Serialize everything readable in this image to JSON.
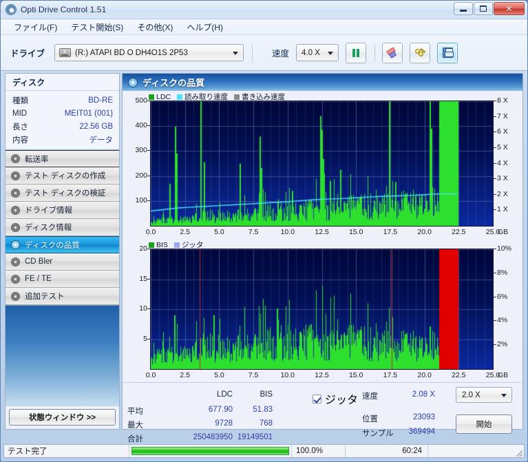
{
  "window": {
    "title": "Opti Drive Control 1.51",
    "icon": "disc-icon",
    "minimize": "–",
    "maximize": "▫",
    "close": "✕"
  },
  "menubar": {
    "items": [
      {
        "label": "ファイル(F)",
        "name": "menu-file"
      },
      {
        "label": "テスト開始(S)",
        "name": "menu-test-start"
      },
      {
        "label": "その他(X)",
        "name": "menu-other"
      },
      {
        "label": "ヘルプ(H)",
        "name": "menu-help"
      }
    ]
  },
  "toolbar": {
    "drive_label": "ドライブ",
    "drive_value": "(R:)   ATAPI BD  O  DH4O1S 2P53",
    "speed_label": "速度",
    "speed_value": "4.0 X",
    "refresh_icon": "refresh-icon",
    "erase_icon": "eraser-icon",
    "keys_icon": "keys-icon",
    "save_icon": "floppy-save-icon"
  },
  "sidebar": {
    "disk_header": "ディスク",
    "disk_info": [
      {
        "key": "種類",
        "value": "BD-RE"
      },
      {
        "key": "MID",
        "value": "MEIT01 (001)"
      },
      {
        "key": "長さ",
        "value": "22.56 GB"
      },
      {
        "key": "内容",
        "value": "データ"
      }
    ],
    "nav": [
      {
        "label": "転送率",
        "selected": false
      },
      {
        "label": "テスト ディスクの作成",
        "selected": false
      },
      {
        "label": "テスト ディスクの検証",
        "selected": false
      },
      {
        "label": "ドライブ情報",
        "selected": false
      },
      {
        "label": "ディスク情報",
        "selected": false
      },
      {
        "label": "ディスクの品質",
        "selected": true
      },
      {
        "label": "CD Bler",
        "selected": false
      },
      {
        "label": "FE / TE",
        "selected": false
      },
      {
        "label": "追加テスト",
        "selected": false
      }
    ],
    "status_window_button": "状態ウィンドウ >>"
  },
  "main": {
    "header_title": "ディスクの品質",
    "header_icon": "disc-quality-icon"
  },
  "stats": {
    "col_headers": [
      "LDC",
      "BIS"
    ],
    "rows": [
      {
        "key": "平均",
        "ldc": "677.90",
        "bis": "51.83"
      },
      {
        "key": "最大",
        "ldc": "9728",
        "bis": "768"
      },
      {
        "key": "合計",
        "ldc": "250483950",
        "bis": "19149501"
      }
    ],
    "jitter_checkbox_label": "ジッタ",
    "jitter_checked": true,
    "speed_label": "速度",
    "speed_value": "2.08 X",
    "speed_select": "2.0 X",
    "position_label": "位置",
    "position_value": "23093",
    "samples_label": "サンプル",
    "samples_value": "369494",
    "start_button": "開始"
  },
  "statusbar": {
    "text": "テスト完了",
    "percent": "100.0%",
    "time": "60:24",
    "progress": 100
  },
  "colors": {
    "ldc_green": "#1aa01a",
    "read_speed_cyan": "#4de3f7",
    "write_speed_gray": "#8a8a8a",
    "bis_green": "#1aa01a",
    "jitter_lilac": "#9aa6ef",
    "plot_bg_top": "#000c44",
    "plot_bg_bottom": "#0a2390",
    "bar_green": "#2ee02e",
    "bar_red": "#e00000",
    "accent_blue": "#2b3ea8"
  },
  "chart_data": [
    {
      "type": "bar",
      "name": "ldc-chart",
      "title": "",
      "legend": [
        {
          "label": "LDC",
          "color": "#1aa01a"
        },
        {
          "label": "読み取り速度",
          "color": "#4de3f7"
        },
        {
          "label": "書き込み速度",
          "color": "#8a8a8a"
        }
      ],
      "legend_position": "top-left",
      "xlabel": "GB",
      "ylabel": "",
      "xlim": [
        0.0,
        25.0
      ],
      "xticks": [
        "0.0",
        "2.5",
        "5.0",
        "7.5",
        "10.0",
        "12.5",
        "15.0",
        "17.5",
        "20.0",
        "22.5",
        "25.0"
      ],
      "xtick_values": [
        0.0,
        2.5,
        5.0,
        7.5,
        10.0,
        12.5,
        15.0,
        17.5,
        20.0,
        22.5,
        25.0
      ],
      "ylim": [
        0,
        500
      ],
      "yticks": [
        "100",
        "200",
        "300",
        "400",
        "500"
      ],
      "ytick_values": [
        100,
        200,
        300,
        400,
        500
      ],
      "y2label": "X",
      "y2lim": [
        0,
        8
      ],
      "y2ticks": [
        "1 X",
        "2 X",
        "3 X",
        "4 X",
        "5 X",
        "6 X",
        "7 X",
        "8 X"
      ],
      "y2tick_values": [
        1,
        2,
        3,
        4,
        5,
        6,
        7,
        8
      ],
      "grid": true,
      "data_end_gb": 22.5,
      "solid_block": {
        "start": 21.1,
        "end": 22.5,
        "color": "#2ee02e"
      },
      "series": [
        {
          "name": "LDC",
          "color": "#1aa01a",
          "kind": "bars",
          "baseline_profile": [
            18,
            22,
            26,
            28,
            30,
            34,
            38,
            40,
            42,
            45,
            48,
            50,
            52,
            55,
            58,
            60,
            62,
            64,
            66,
            68,
            70,
            72,
            74,
            76,
            78,
            80,
            82,
            84,
            86,
            88,
            90,
            92,
            94,
            96,
            98,
            100,
            102,
            104,
            106,
            108
          ],
          "spikes": [
            {
              "x": 1.35,
              "y": 168
            },
            {
              "x": 1.75,
              "y": 398
            },
            {
              "x": 1.85,
              "y": 290
            },
            {
              "x": 3.6,
              "y": 500
            },
            {
              "x": 3.85,
              "y": 255
            },
            {
              "x": 6.5,
              "y": 250
            },
            {
              "x": 7.95,
              "y": 358
            },
            {
              "x": 8.05,
              "y": 232
            },
            {
              "x": 10.3,
              "y": 140
            },
            {
              "x": 12.35,
              "y": 440
            },
            {
              "x": 12.45,
              "y": 385
            },
            {
              "x": 12.6,
              "y": 268
            },
            {
              "x": 12.65,
              "y": 210
            },
            {
              "x": 13.1,
              "y": 180
            },
            {
              "x": 13.85,
              "y": 225
            },
            {
              "x": 17.4,
              "y": 500
            },
            {
              "x": 17.85,
              "y": 175
            },
            {
              "x": 20.35,
              "y": 500
            },
            {
              "x": 20.45,
              "y": 390
            }
          ]
        },
        {
          "name": "読み取り速度",
          "color": "#4de3f7",
          "kind": "line",
          "axis": "right",
          "points": [
            [
              0.0,
              0.95
            ],
            [
              1.0,
              1.05
            ],
            [
              2.0,
              1.15
            ],
            [
              3.0,
              1.2
            ],
            [
              4.0,
              1.25
            ],
            [
              5.0,
              1.3
            ],
            [
              6.0,
              1.35
            ],
            [
              7.0,
              1.4
            ],
            [
              8.0,
              1.45
            ],
            [
              9.0,
              1.5
            ],
            [
              10.0,
              1.55
            ],
            [
              11.0,
              1.62
            ],
            [
              12.0,
              1.68
            ],
            [
              13.0,
              1.72
            ],
            [
              14.0,
              1.75
            ],
            [
              15.0,
              1.8
            ],
            [
              16.0,
              1.85
            ],
            [
              17.0,
              1.9
            ],
            [
              18.0,
              1.92
            ],
            [
              19.0,
              1.95
            ],
            [
              20.0,
              2.0
            ],
            [
              21.0,
              2.05
            ],
            [
              22.4,
              2.05
            ]
          ]
        }
      ]
    },
    {
      "type": "bar",
      "name": "bis-chart",
      "title": "",
      "legend": [
        {
          "label": "BIS",
          "color": "#1aa01a"
        },
        {
          "label": "ジッタ",
          "color": "#9aa6ef"
        }
      ],
      "legend_position": "top-left",
      "xlabel": "GB",
      "ylabel": "",
      "xlim": [
        0.0,
        25.0
      ],
      "xticks": [
        "0.0",
        "2.5",
        "5.0",
        "7.5",
        "10.0",
        "12.5",
        "15.0",
        "17.5",
        "20.0",
        "22.5",
        "25.0"
      ],
      "xtick_values": [
        0.0,
        2.5,
        5.0,
        7.5,
        10.0,
        12.5,
        15.0,
        17.5,
        20.0,
        22.5,
        25.0
      ],
      "ylim": [
        0,
        20
      ],
      "yticks": [
        "5",
        "10",
        "15",
        "20"
      ],
      "ytick_values": [
        5,
        10,
        15,
        20
      ],
      "y2label": "%",
      "y2lim": [
        0,
        10
      ],
      "y2ticks": [
        "2%",
        "4%",
        "6%",
        "8%",
        "10%"
      ],
      "y2tick_values": [
        2,
        4,
        6,
        8,
        10
      ],
      "grid": true,
      "data_end_gb": 22.5,
      "solid_block": {
        "start": 21.1,
        "end": 22.5,
        "color": "#e00000"
      },
      "marker_lines": [
        {
          "x": 3.55,
          "color": "#b03030"
        },
        {
          "x": 17.6,
          "color": "#b03030"
        }
      ],
      "series": [
        {
          "name": "BIS",
          "color": "#1aa01a",
          "kind": "bars",
          "baseline_profile": [
            2.2,
            2.4,
            2.6,
            2.8,
            3.0,
            3.2,
            3.4,
            3.6,
            3.8,
            4.0,
            4.2,
            4.3,
            4.4,
            4.5,
            4.6,
            4.7,
            4.8,
            4.9,
            5.0,
            5.0,
            5.0,
            5.0,
            5.0,
            5.0,
            5.0,
            4.9,
            4.8,
            4.7,
            4.6,
            4.5,
            4.4,
            4.4,
            4.3,
            4.3,
            4.2,
            4.2,
            4.1,
            4.1,
            4.0,
            4.0
          ],
          "max_value": 10.1,
          "spikes": [
            {
              "x": 1.7,
              "y": 9.0
            },
            {
              "x": 4.6,
              "y": 9.0
            },
            {
              "x": 9.2,
              "y": 10.1
            },
            {
              "x": 13.9,
              "y": 5.7
            },
            {
              "x": 20.35,
              "y": 7.1
            }
          ]
        }
      ]
    }
  ]
}
